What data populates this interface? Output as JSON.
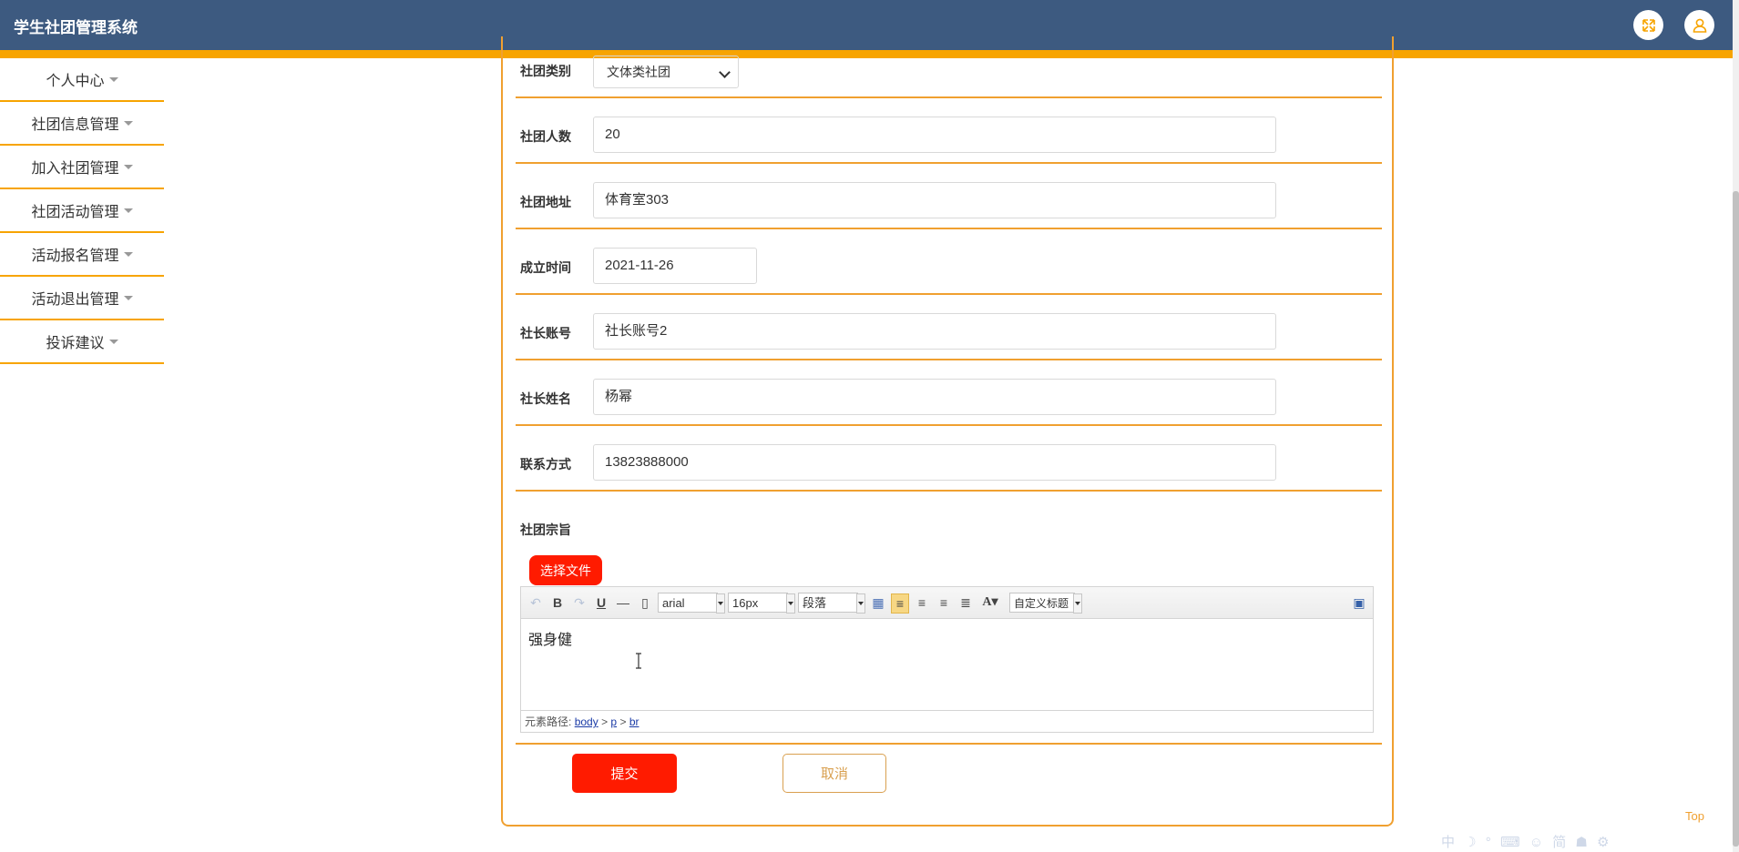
{
  "header": {
    "title": "学生社团管理系统",
    "fullscreen_icon": "fullscreen-icon",
    "user_icon": "user-icon",
    "colors": {
      "bar": "#3d5a80",
      "accent": "#f7a400"
    }
  },
  "sidebar": {
    "items": [
      {
        "label": "个人中心"
      },
      {
        "label": "社团信息管理"
      },
      {
        "label": "加入社团管理"
      },
      {
        "label": "社团活动管理"
      },
      {
        "label": "活动报名管理"
      },
      {
        "label": "活动退出管理"
      },
      {
        "label": "投诉建议"
      }
    ]
  },
  "form": {
    "category": {
      "label": "社团类别",
      "value": "文体类社团"
    },
    "members": {
      "label": "社团人数",
      "value": "20"
    },
    "address": {
      "label": "社团地址",
      "value": "体育室303"
    },
    "founded": {
      "label": "成立时间",
      "value": "2021-11-26"
    },
    "leader_account": {
      "label": "社长账号",
      "value": "社长账号2"
    },
    "leader_name": {
      "label": "社长姓名",
      "value": "杨幂"
    },
    "contact": {
      "label": "联系方式",
      "value": "13823888000"
    },
    "purpose": {
      "label": "社团宗旨"
    },
    "file_button": "选择文件",
    "editor": {
      "font_family": "arial",
      "font_size": "16px",
      "paragraph": "段落",
      "custom_title": "自定义标题",
      "content": "强身健",
      "path_label": "元素路径:",
      "path": [
        "body",
        "p",
        "br"
      ],
      "path_sep": ">"
    },
    "submit": "提交",
    "cancel": "取消"
  },
  "footer": {
    "top_link": "Top"
  },
  "ime_bar": "中 ☽ ° ⌨ ☺ 简 ☗ ⚙"
}
